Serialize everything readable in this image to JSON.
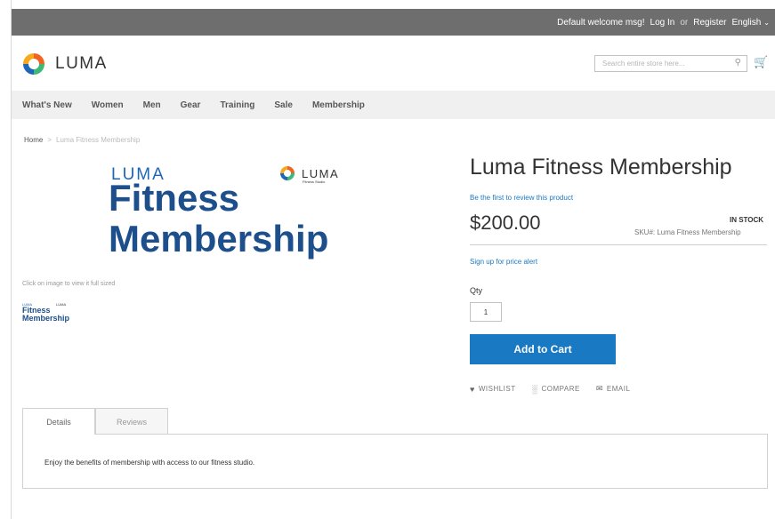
{
  "topbar": {
    "welcome": "Default welcome msg!",
    "login": "Log In",
    "or": "or",
    "register": "Register",
    "language": "English"
  },
  "header": {
    "logo_text": "LUMA",
    "search_placeholder": "Search entire store here...",
    "brand_colors": {
      "orange": "#f26322",
      "blue": "#1f66b6",
      "green": "#3cb878"
    }
  },
  "nav": {
    "items": [
      "What's New",
      "Women",
      "Men",
      "Gear",
      "Training",
      "Sale",
      "Membership"
    ]
  },
  "breadcrumb": {
    "home": "Home",
    "separator": ">",
    "current": "Luma Fitness Membership"
  },
  "media": {
    "image_luma": "LUMA",
    "image_line1": "Fitness",
    "image_line2": "Membership",
    "studio_logo_text": "LUMA",
    "studio_logo_sub": "Fitness Studio",
    "zoom_note": "Click on image to view it full sized",
    "thumb_luma": "LUMA",
    "thumb_line1": "Fitness",
    "thumb_line2": "Membership",
    "thumb_logo": "LUMA"
  },
  "product": {
    "title": "Luma Fitness Membership",
    "review_link": "Be the first to review this product",
    "price": "$200.00",
    "stock": "IN STOCK",
    "sku_label": "SKU#:",
    "sku_value": "Luma Fitness Membership",
    "price_alert": "Sign up for price alert",
    "qty_label": "Qty",
    "qty_value": "1",
    "add_to_cart": "Add to Cart",
    "accent_color": "#1979c3"
  },
  "actions": {
    "wishlist": "WISHLIST",
    "compare": "COMPARE",
    "email": "EMAIL"
  },
  "tabs": {
    "details": "Details",
    "reviews": "Reviews",
    "description": "Enjoy the benefits of membership with access to our fitness studio."
  }
}
